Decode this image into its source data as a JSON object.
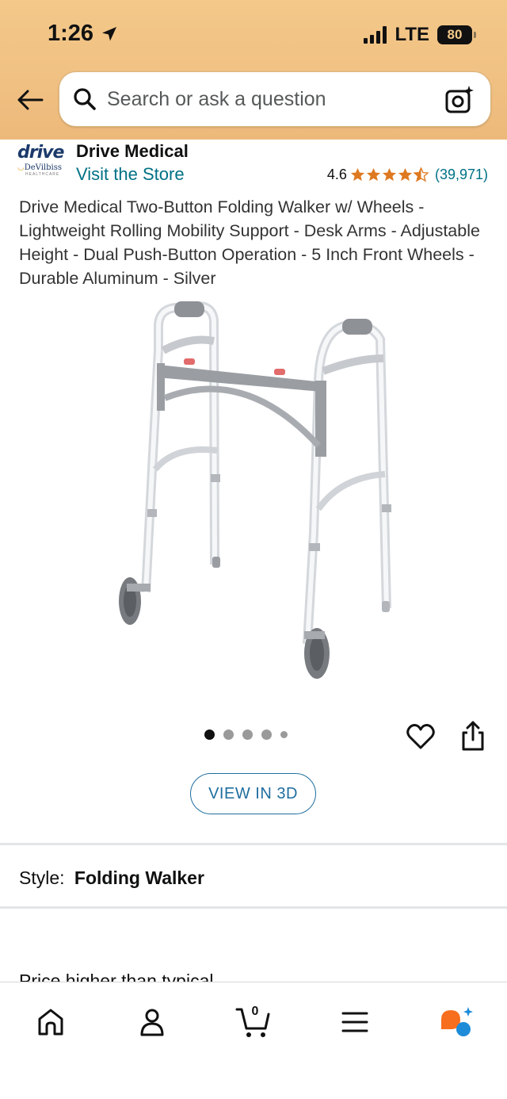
{
  "status_bar": {
    "time": "1:26",
    "network": "LTE",
    "battery": "80"
  },
  "search": {
    "placeholder": "Search or ask a question"
  },
  "brand": {
    "logo_text": "drive",
    "logo_subtext": "DeVilbiss",
    "logo_subtext2": "HEALTHCARE",
    "name": "Drive Medical",
    "visit_store": "Visit the Store"
  },
  "rating": {
    "value": "4.6",
    "stars": 4.5,
    "count": "(39,971)",
    "star_color": "#de7921"
  },
  "product": {
    "title": "Drive Medical Two-Button Folding Walker w/ Wheels - Lightweight Rolling Mobility Support - Desk Arms - Adjustable Height - Dual Push-Button Operation - 5 Inch Front Wheels - Durable Aluminum - Silver",
    "image_icon": "folding-walker-image",
    "image_count": 5,
    "active_image": 1
  },
  "actions": {
    "view_3d": "VIEW IN 3D",
    "heart_icon": "heart-icon",
    "share_icon": "share-icon"
  },
  "style": {
    "label": "Style:",
    "value": "Folding Walker"
  },
  "price_teaser": "Price higher than typical",
  "bottom_nav": {
    "items": [
      {
        "icon": "home-icon"
      },
      {
        "icon": "account-icon"
      },
      {
        "icon": "cart-icon",
        "count": "0"
      },
      {
        "icon": "menu-icon"
      },
      {
        "icon": "rufus-assistant-icon"
      }
    ]
  },
  "colors": {
    "header": "#f0c183",
    "link": "#007185",
    "button_border": "#1f6e9f"
  }
}
